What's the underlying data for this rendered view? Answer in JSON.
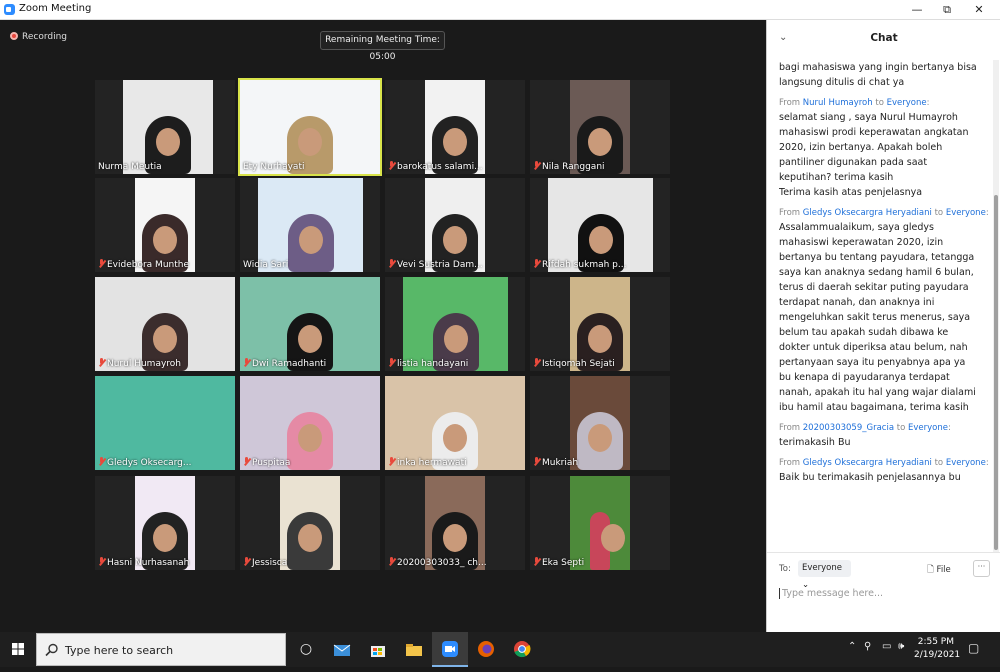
{
  "window": {
    "title": "Zoom Meeting",
    "minimize": "—",
    "restore": "⧉",
    "close": "✕"
  },
  "meeting": {
    "recording_label": "Recording",
    "remaining_time_label": "Remaining Meeting Time: 05:00"
  },
  "participants": [
    {
      "name": "Nurma Meutia",
      "muted": false
    },
    {
      "name": "Ety Nurhayati",
      "muted": false
    },
    {
      "name": "barokatus salami...",
      "muted": true
    },
    {
      "name": "Nila Ranggani",
      "muted": true
    },
    {
      "name": "Evidebora Munthe",
      "muted": true
    },
    {
      "name": "Widia Sari",
      "muted": false
    },
    {
      "name": "Vevi Sustria Dam...",
      "muted": true
    },
    {
      "name": "Rifdah sukmah p...",
      "muted": true
    },
    {
      "name": "Nurul Humayroh",
      "muted": true
    },
    {
      "name": "Dwi Ramadhanti",
      "muted": true
    },
    {
      "name": "listia handayani",
      "muted": true
    },
    {
      "name": "Istiqomah Sejati",
      "muted": true
    },
    {
      "name": "Gledys Oksecarg...",
      "muted": true
    },
    {
      "name": "Puspitaa",
      "muted": true
    },
    {
      "name": "inka hermawati",
      "muted": true
    },
    {
      "name": "Mukriah",
      "muted": true
    },
    {
      "name": "Hasni Nurhasanah",
      "muted": true
    },
    {
      "name": "Jessisca",
      "muted": true
    },
    {
      "name": "20200303033_ ch...",
      "muted": true
    },
    {
      "name": "Eka Septi",
      "muted": true
    }
  ],
  "chat": {
    "title": "Chat",
    "collapse_icon": "⌄",
    "messages": [
      {
        "from": "",
        "to": "",
        "lines": [
          "bagi mahasiswa yang ingin bertanya bisa",
          "langsung ditulis di chat ya"
        ]
      },
      {
        "from": "Nurul Humayroh",
        "to": "Everyone",
        "lines": [
          "selamat siang , saya Nurul Humayroh",
          "mahasiswi prodi keperawatan angkatan",
          "2020, izin bertanya. Apakah boleh",
          "pantiliner digunakan pada saat",
          "keputihan? terima kasih",
          "Terima kasih atas penjelasnya"
        ]
      },
      {
        "from": "Gledys Oksecargra Heryadiani",
        "to": "Everyone",
        "lines": [
          "Assalammualaikum, saya gledys",
          "mahasiswi keperawatan 2020, izin",
          "bertanya bu tentang payudara, tetangga",
          "saya kan anaknya sedang hamil 6 bulan,",
          "terus di daerah sekitar puting payudara",
          "terdapat nanah, dan anaknya ini",
          "mengeluhkan sakit terus menerus, saya",
          "belum tau apakah sudah dibawa ke",
          "dokter untuk diperiksa atau belum, nah",
          "pertanyaan saya itu penyabnya apa ya",
          "bu kenapa di payudaranya terdapat",
          "nanah, apakah itu hal yang wajar dialami",
          "ibu hamil atau bagaimana, terima kasih"
        ]
      },
      {
        "from": "20200303059_Gracia",
        "to": "Everyone",
        "lines": [
          "terimakasih Bu"
        ]
      },
      {
        "from": "Gledys Oksecargra Heryadiani",
        "to": "Everyone",
        "lines": [
          "Baik bu terimakasih penjelasannya bu"
        ]
      }
    ],
    "from_word": "From",
    "to_word": "to",
    "to_label": "To:",
    "recipient": "Everyone",
    "file_label": "File",
    "more_label": "···",
    "input_placeholder": "Type message here..."
  },
  "taskbar": {
    "search_placeholder": "Type here to search",
    "time": "2:55 PM",
    "date": "2/19/2021"
  }
}
